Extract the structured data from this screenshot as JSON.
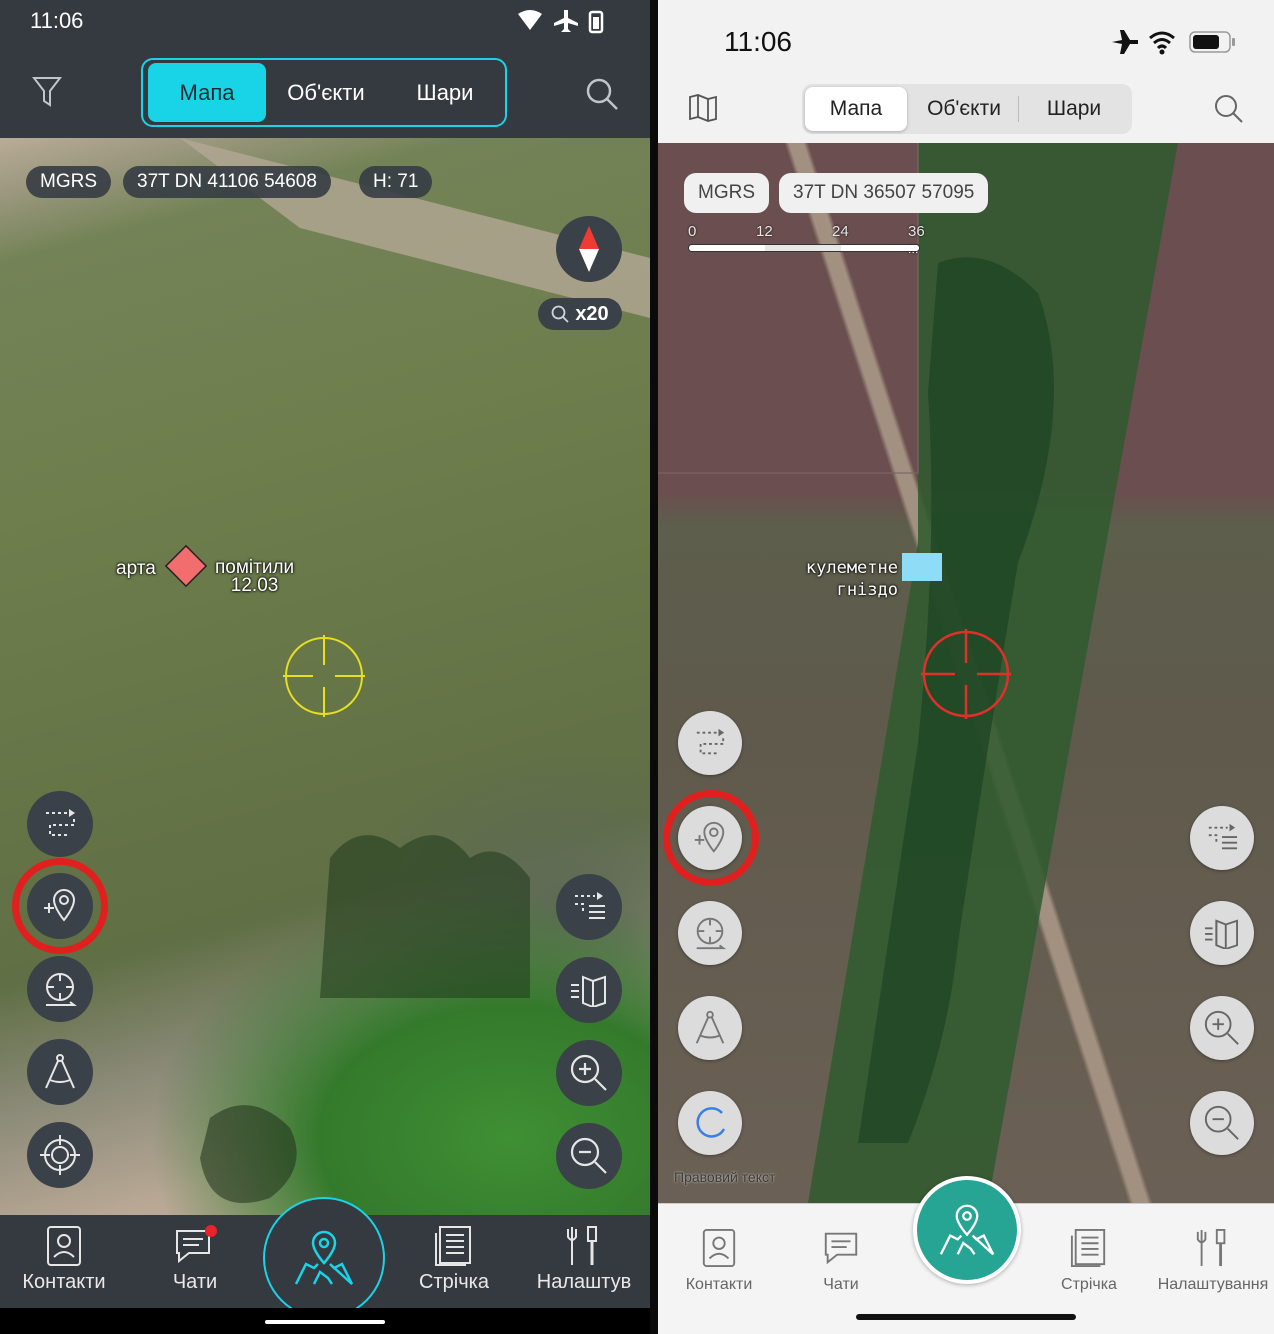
{
  "android": {
    "status_time": "11:06",
    "tabs": [
      {
        "label": "Мапа"
      },
      {
        "label": "Об'єкти"
      },
      {
        "label": "Шари"
      }
    ],
    "coords": {
      "system": "MGRS",
      "value": "37T DN 41106 54608",
      "height": "H: 71"
    },
    "zoom": "x20",
    "marker": {
      "label_left": "арта",
      "label_right": "помітили",
      "label_date": "12.03"
    },
    "nav": [
      {
        "label": "Контакти"
      },
      {
        "label": "Чати"
      },
      {
        "label": ""
      },
      {
        "label": "Стрічка"
      },
      {
        "label": "Налаштув"
      }
    ],
    "colors": {
      "accent": "#19d3e6",
      "bg": "#343a40",
      "marker": "#f26d6d",
      "crosshair": "#e6e020",
      "alert": "#e0201e"
    }
  },
  "ios": {
    "status_time": "11:06",
    "tabs": [
      {
        "label": "Мапа"
      },
      {
        "label": "Об'єкти"
      },
      {
        "label": "Шари"
      }
    ],
    "coords": {
      "system": "MGRS",
      "value": "37T DN 36507 57095"
    },
    "scale": {
      "ticks": [
        "0",
        "12",
        "24",
        "36 м"
      ]
    },
    "marker": {
      "label_line1": "кулеметне",
      "label_line2": "гніздо"
    },
    "legal": "Правовий текст",
    "nav": [
      {
        "label": "Контакти"
      },
      {
        "label": "Чати"
      },
      {
        "label": ""
      },
      {
        "label": "Стрічка"
      },
      {
        "label": "Налаштування"
      }
    ],
    "colors": {
      "accent": "#26a594",
      "marker": "#8fdcf7",
      "crosshair": "#e0302a"
    }
  }
}
